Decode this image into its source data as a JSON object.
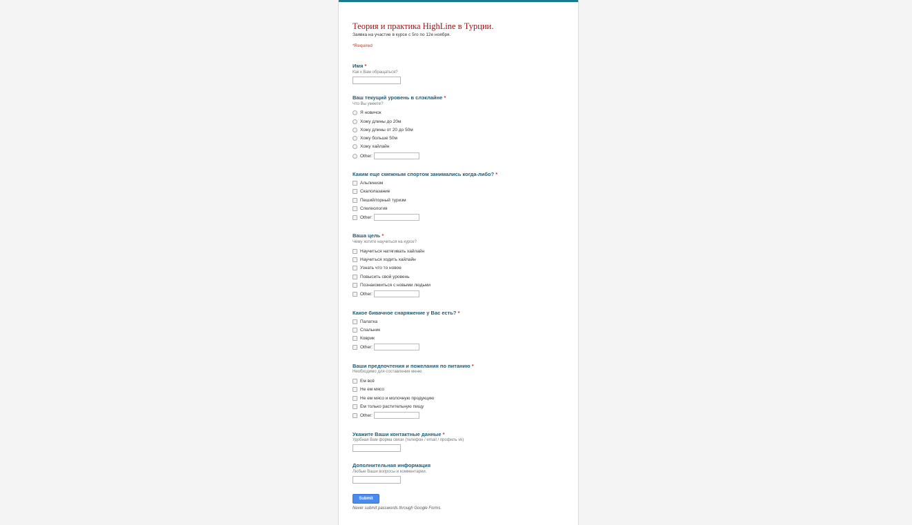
{
  "form": {
    "title": "Теория и практика HighLine в Турции.",
    "description": "Заявка на участие в курсе с 5го по 12е ноября.",
    "required_note": "*Required",
    "accent_color": "#1b7a8f",
    "title_color": "#a01010",
    "question_color": "#1f5b75"
  },
  "q1": {
    "title": "Имя",
    "star": "*",
    "help": "Как к Вам обращаться?"
  },
  "q2": {
    "title": "Ваш текущий уровень в слэклайне",
    "star": "*",
    "help": "Что Вы умеете?",
    "options": [
      "Я новичок",
      "Хожу длины до 20м",
      "Хожу длины от 20 до 50м",
      "Хожу больше 50м",
      "Хожу хайлайн"
    ],
    "other": "Other:"
  },
  "q3": {
    "title": "Каким еще смежным спортом занимались когда-либо?",
    "star": "*",
    "options": [
      "Альпинизм",
      "Скалолазание",
      "Пеший/горный туризм",
      "Спелеология"
    ],
    "other": "Other:"
  },
  "q4": {
    "title": "Ваша цель",
    "star": "*",
    "help": "Чему хотите научиться на курсе?",
    "options": [
      "Научиться натягивать хайлайн",
      "Научиться ходить хайлайн",
      "Узнать что то новое",
      "Повысить свой уровень",
      "Познакомиться с новыми людьми"
    ],
    "other": "Other:"
  },
  "q5": {
    "title": "Какое бивачное снаряжение у Вас есть?",
    "star": "*",
    "options": [
      "Палатка",
      "Спальник",
      "Коврик"
    ],
    "other": "Other:"
  },
  "q6": {
    "title": "Ваши предпочтения и пожелания по питанию",
    "star": "*",
    "help": "Необходимо для составления меню",
    "options": [
      "Ем всё",
      "Не ем мясо",
      "Не ем мясо и молочную продукцию",
      "Ем только растительную пищу"
    ],
    "other": "Other:"
  },
  "q7": {
    "title": "Укажите Ваши контактные данные",
    "star": "*",
    "help": "Удобная Вам форма связи (телефон / email / профиль vk)"
  },
  "q8": {
    "title": "Дополнительная информация",
    "help": "Любые Ваши вопросы и комментарии."
  },
  "footer": {
    "submit": "Submit",
    "warning": "Never submit passwords through Google Forms."
  }
}
